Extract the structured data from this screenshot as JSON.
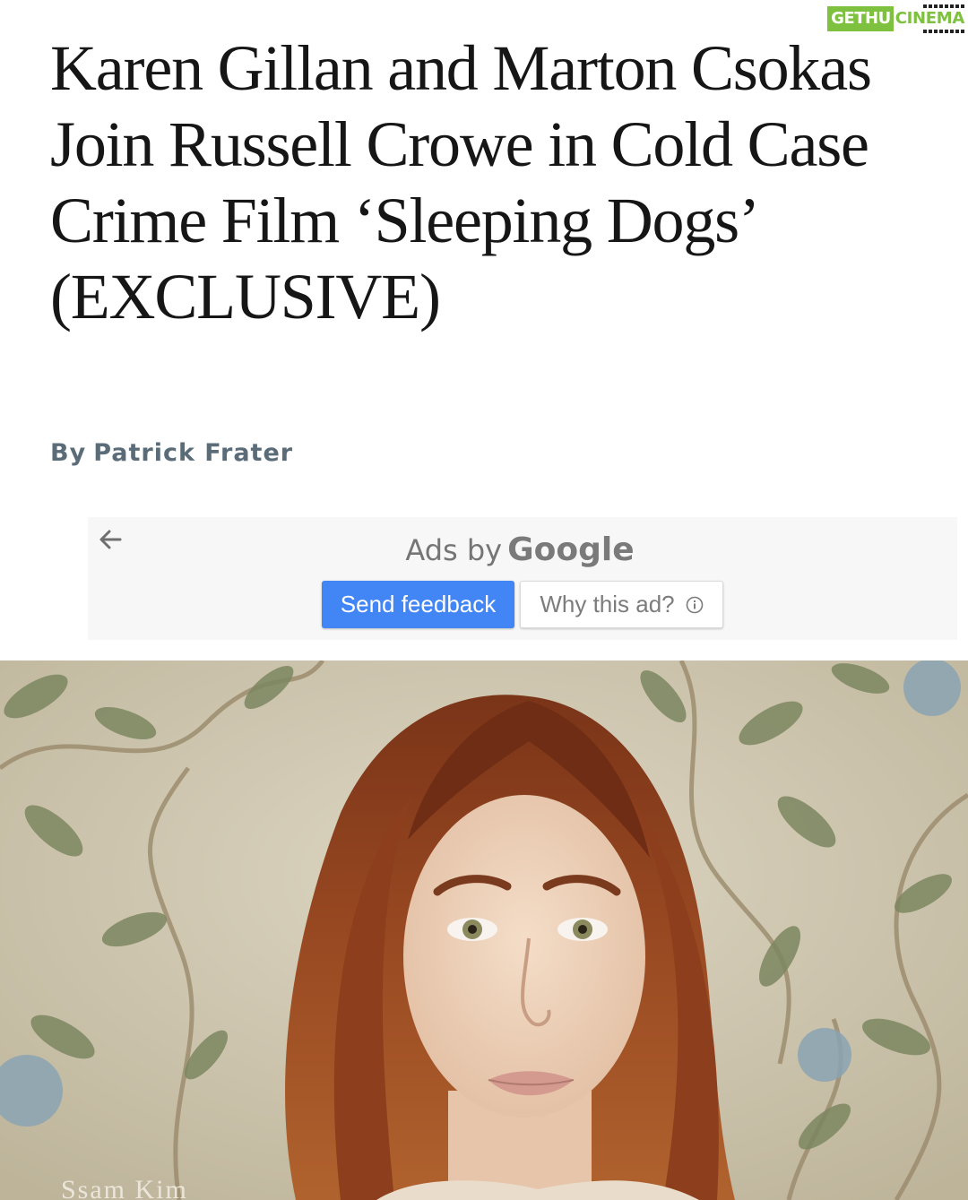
{
  "watermark": {
    "part1": "GETHU",
    "part2": "CINEMA"
  },
  "article": {
    "headline": "Karen Gillan and Marton Csokas Join Russell Crowe in Cold Case Crime Film ‘Sleeping Dogs’ (EXCLUSIVE)",
    "byline_prefix": "By",
    "author": "Patrick Frater"
  },
  "ad": {
    "ads_by": "Ads by",
    "brand": "Google",
    "send_feedback": "Send feedback",
    "why_this_ad": "Why this ad?"
  },
  "photo": {
    "credit": "Ssam Kim"
  },
  "colors": {
    "accent_blue": "#4285f4",
    "byline_gray": "#5b6c79",
    "watermark_green": "#7dc13f"
  }
}
